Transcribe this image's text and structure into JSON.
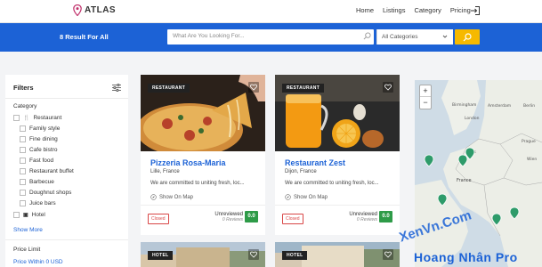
{
  "header": {
    "brand": "ATLAS",
    "nav": [
      "Home",
      "Listings",
      "Category",
      "Pricing"
    ]
  },
  "search_band": {
    "result_count": "8 Result For All",
    "search_placeholder": "What Are You Looking For...",
    "category_selected": "All Categories"
  },
  "filters": {
    "title": "Filters",
    "category_label": "Category",
    "items": [
      {
        "label": "Restaurant",
        "icon": "utensils-icon",
        "indent": false
      },
      {
        "label": "Family style",
        "indent": true
      },
      {
        "label": "Fine dining",
        "indent": true
      },
      {
        "label": "Cafe bistro",
        "indent": true
      },
      {
        "label": "Fast food",
        "indent": true
      },
      {
        "label": "Restaurant buffet",
        "indent": true
      },
      {
        "label": "Barbecue",
        "indent": true
      },
      {
        "label": "Doughnut shops",
        "indent": true
      },
      {
        "label": "Juice bars",
        "indent": true
      },
      {
        "label": "Hotel",
        "icon": "hotel-icon",
        "indent": false
      }
    ],
    "show_more": "Show More",
    "price_limit": "Price Limit",
    "price_within": "Price Within 0 USD"
  },
  "listings": [
    {
      "badge": "RESTAURANT",
      "title": "Pizzeria Rosa-Maria",
      "location": "Lille, France",
      "description": "We are committed to uniting fresh, loc...",
      "map_link": "Show On Map",
      "status": "Closed",
      "review_status": "Unreviewed",
      "review_count": "0 Reviews",
      "score": "0.0"
    },
    {
      "badge": "RESTAURANT",
      "title": "Restaurant Zest",
      "location": "Dijon, France",
      "description": "We are committed to uniting fresh, loc...",
      "map_link": "Show On Map",
      "status": "Closed",
      "review_status": "Unreviewed",
      "review_count": "0 Reviews",
      "score": "0.0"
    },
    {
      "badge": "HOTEL"
    },
    {
      "badge": "HOTEL"
    }
  ],
  "map": {
    "zoom_in": "+",
    "zoom_out": "−",
    "labels": [
      "Birmingham",
      "London",
      "Amsterdam",
      "Berlin",
      "Paris",
      "France",
      "Prague",
      "Wien"
    ]
  },
  "watermark": {
    "line1": "XenVn.Com",
    "line2": "Hoang Nhân Pro"
  },
  "colors": {
    "primary": "#1c62d6",
    "accent": "#f6b900",
    "score_green": "#2e9b48",
    "closed_red": "#d94646"
  }
}
